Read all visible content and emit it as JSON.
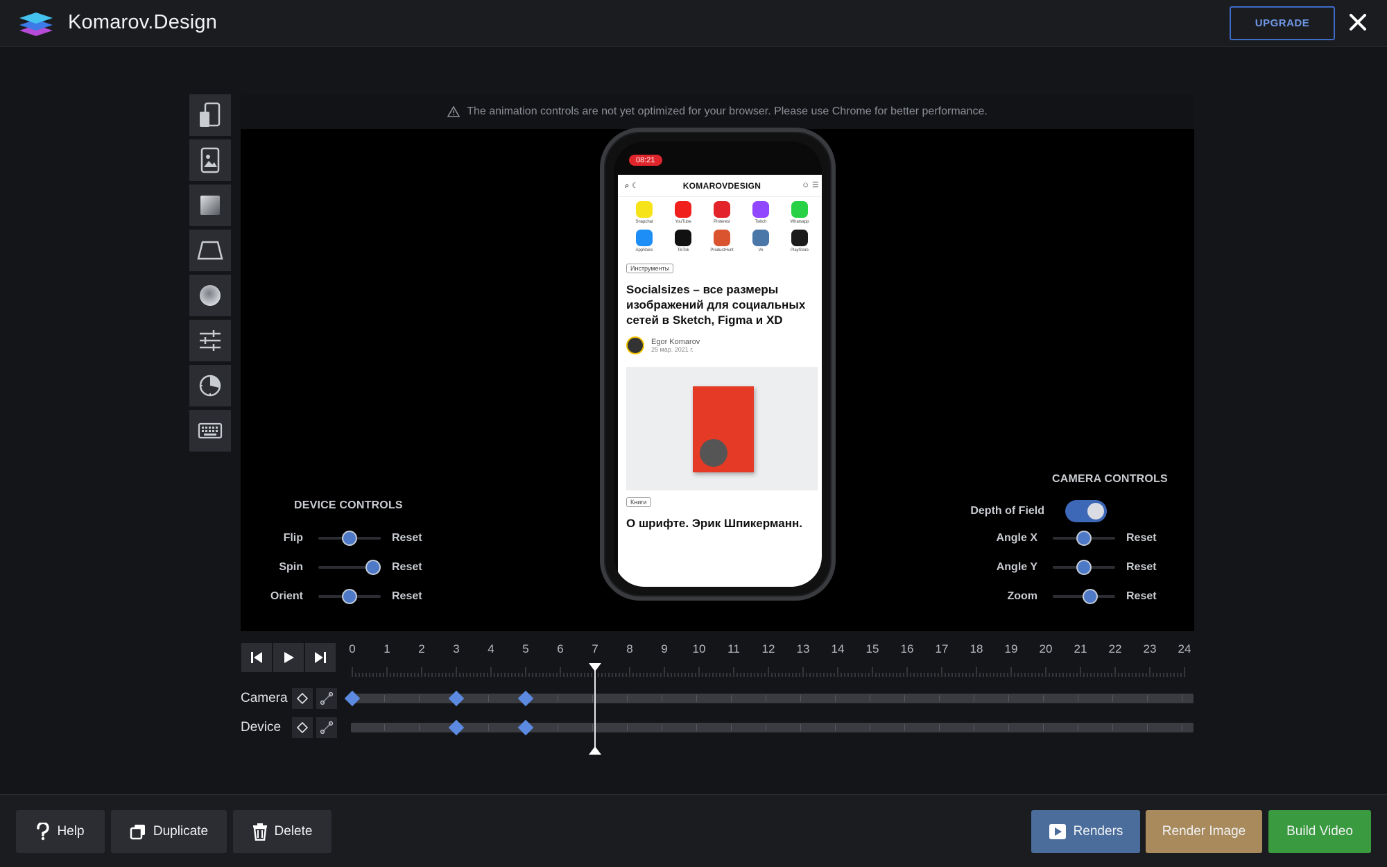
{
  "header": {
    "title": "Komarov.Design",
    "upgrade_label": "UPGRADE"
  },
  "toolbar": {
    "tools": [
      "device-icon",
      "image-icon",
      "background-icon",
      "perspective-icon",
      "lighting-icon",
      "adjustments-icon",
      "timer-icon",
      "keyboard-icon"
    ]
  },
  "stage": {
    "warning": "The animation controls are not yet optimized for your browser. Please use Chrome for better performance."
  },
  "phone": {
    "time": "08:21",
    "site_name": "KOMAROVDESIGN",
    "apps": [
      {
        "label": "Snapchat",
        "color": "#f7e31a"
      },
      {
        "label": "YouTube",
        "color": "#f0201d"
      },
      {
        "label": "Pinterest",
        "color": "#e3242b"
      },
      {
        "label": "Twitch",
        "color": "#9146ff"
      },
      {
        "label": "Whatsapp",
        "color": "#28d146"
      },
      {
        "label": "AppStore",
        "color": "#1e8ef7"
      },
      {
        "label": "TikTok",
        "color": "#111111"
      },
      {
        "label": "ProductHunt",
        "color": "#da552f"
      },
      {
        "label": "Vk",
        "color": "#4a76a8"
      },
      {
        "label": "PlayStore",
        "color": "#1b1b1b"
      }
    ],
    "tag1": "Инструменты",
    "headline1": "Socialsizes – все размеры изображений для социальных сетей в Sketch, Figma и XD",
    "author": "Egor Komarov",
    "date": "25 мар. 2021 г.",
    "tag2": "Книги",
    "headline2": "О шрифте. Эрик Шпикерманн."
  },
  "device_controls": {
    "title": "DEVICE CONTROLS",
    "reset_label": "Reset",
    "rows": [
      {
        "label": "Flip",
        "value": 0.5
      },
      {
        "label": "Spin",
        "value": 0.88
      },
      {
        "label": "Orient",
        "value": 0.5
      }
    ]
  },
  "camera_controls": {
    "title": "CAMERA CONTROLS",
    "dof_label": "Depth of Field",
    "dof_on": true,
    "reset_label": "Reset",
    "rows": [
      {
        "label": "Angle X",
        "value": 0.5
      },
      {
        "label": "Angle Y",
        "value": 0.5
      },
      {
        "label": "Zoom",
        "value": 0.6
      }
    ]
  },
  "timeline": {
    "ticks": [
      "0",
      "1",
      "2",
      "3",
      "4",
      "5",
      "6",
      "7",
      "8",
      "9",
      "10",
      "11",
      "12",
      "13",
      "14",
      "15",
      "16",
      "17",
      "18",
      "19",
      "20",
      "21",
      "22",
      "23",
      "24"
    ],
    "playhead": 7,
    "tracks": [
      {
        "label": "Camera",
        "keyframes": [
          0,
          3,
          5
        ]
      },
      {
        "label": "Device",
        "keyframes": [
          3,
          5
        ]
      }
    ]
  },
  "footer": {
    "help_label": "Help",
    "duplicate_label": "Duplicate",
    "delete_label": "Delete",
    "renders_label": "Renders",
    "render_image_label": "Render Image",
    "build_video_label": "Build Video",
    "renders_color": "#4a6d9c",
    "render_image_color": "#a88a5c",
    "build_video_color": "#3a9a3f"
  }
}
